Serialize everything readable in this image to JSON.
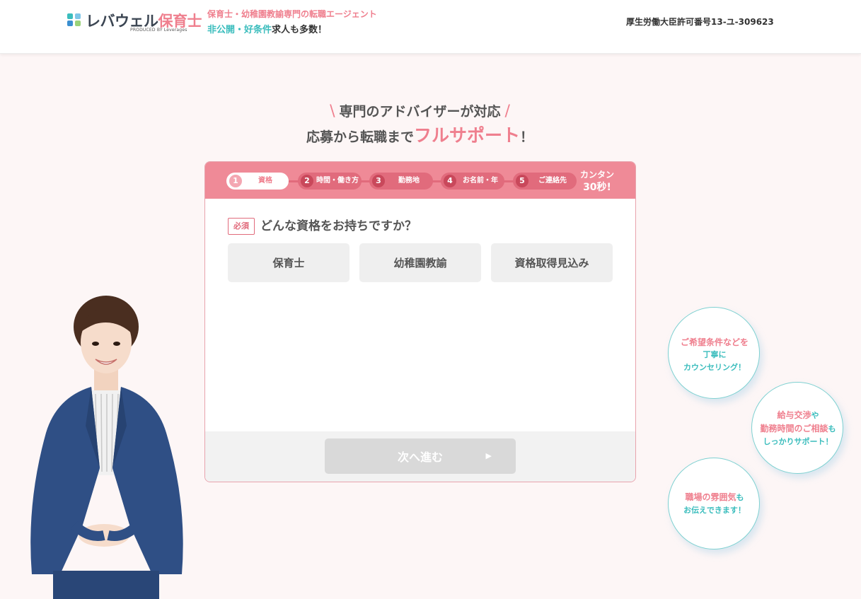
{
  "header": {
    "logo_name_part1": "レバウェル",
    "logo_name_part2": "保育士",
    "logo_sub": "PRODUCED BY Leverages",
    "tagline1": "保育士・幼稚園教諭専門の転職エージェント",
    "tagline2_highlight": "非公開・好条件",
    "tagline2_rest": "求人も多数！",
    "license": "厚生労働大臣許可番号13-ユ-309623"
  },
  "hero": {
    "line1": "専門のアドバイザーが対応",
    "slash_left": "\\",
    "slash_right": "/",
    "line2_prefix": "応募から転職まで",
    "line2_highlight": "フルサポート",
    "line2_suffix": "！"
  },
  "form": {
    "steps": [
      {
        "num": "1",
        "label": "資格",
        "active": true
      },
      {
        "num": "2",
        "label": "時間・働き方",
        "active": false
      },
      {
        "num": "3",
        "label": "勤務地",
        "active": false
      },
      {
        "num": "4",
        "label": "お名前・年",
        "active": false
      },
      {
        "num": "5",
        "label": "ご連絡先",
        "active": false
      }
    ],
    "easy_line1": "カンタン",
    "easy_line2": "30秒!",
    "required_label": "必須",
    "question": "どんな資格をお持ちですか？",
    "options": [
      "保育士",
      "幼稚園教諭",
      "資格取得見込み"
    ],
    "next_label": "次へ進む",
    "next_icon": "chevron-right-icon"
  },
  "bubbles": [
    {
      "line1": "ご希望条件などを",
      "line2": "丁寧に",
      "line3": "カウンセリング！"
    },
    {
      "line1": "給与交渉",
      "line1b": "や",
      "line2": "勤務時間のご相談",
      "line2b": "も",
      "line3": "しっかりサポート！"
    },
    {
      "line1": "職場の雰囲気",
      "line1b": "も",
      "line2": "お伝えできます！"
    }
  ],
  "colors": {
    "brand_pink": "#ef7f8e",
    "brand_teal": "#3bbdbd",
    "step_bar": "#ef8a97",
    "background": "#fdf6f6"
  }
}
